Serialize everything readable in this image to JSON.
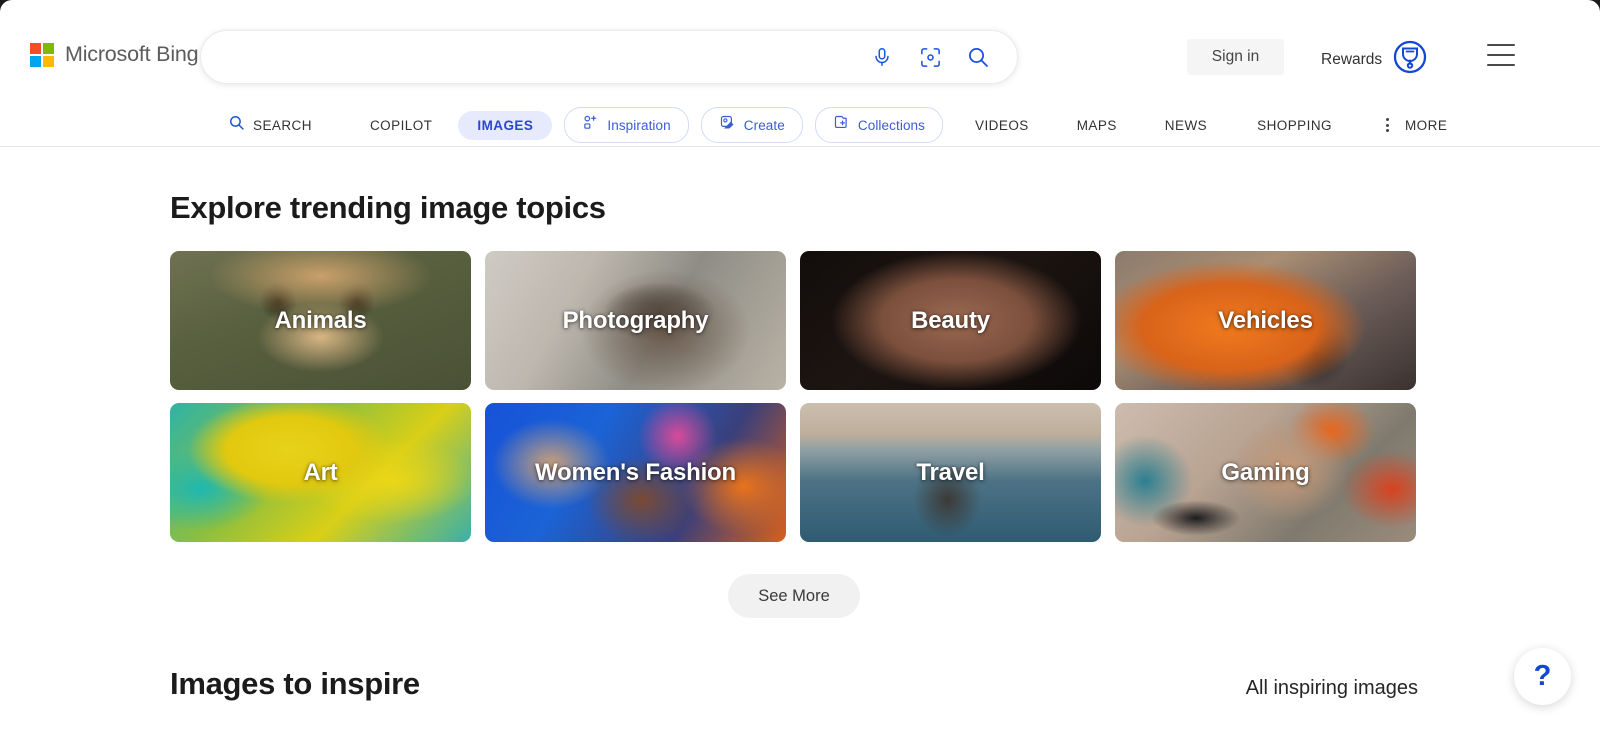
{
  "browser": {
    "frame_color": "#1b1b1b"
  },
  "header": {
    "brand": {
      "name": "Microsoft Bing",
      "logo": "microsoft-logo"
    },
    "search": {
      "value": "",
      "placeholder": "",
      "icons": [
        "microphone-icon",
        "visual-search-icon",
        "search-icon"
      ]
    },
    "sign_in_label": "Sign in",
    "rewards_label": "Rewards",
    "rewards_icon": "rewards-medal-icon",
    "menu_icon": "hamburger-menu-icon"
  },
  "nav": {
    "items": [
      {
        "label": "SEARCH",
        "style": "plain",
        "icon": "search-icon"
      },
      {
        "label": "COPILOT",
        "style": "plain",
        "icon": ""
      },
      {
        "label": "IMAGES",
        "style": "active",
        "icon": ""
      },
      {
        "label": "Inspiration",
        "style": "pill",
        "icon": "inspiration-icon"
      },
      {
        "label": "Create",
        "style": "pill",
        "icon": "create-icon"
      },
      {
        "label": "Collections",
        "style": "pill",
        "icon": "collections-icon"
      },
      {
        "label": "VIDEOS",
        "style": "plain",
        "icon": ""
      },
      {
        "label": "MAPS",
        "style": "plain",
        "icon": ""
      },
      {
        "label": "NEWS",
        "style": "plain",
        "icon": ""
      },
      {
        "label": "SHOPPING",
        "style": "plain",
        "icon": ""
      },
      {
        "label": "MORE",
        "style": "plain",
        "icon": "more-dots-icon"
      }
    ]
  },
  "main": {
    "trending_title": "Explore trending image topics",
    "topics": [
      {
        "label": "Animals",
        "art": "art-animals"
      },
      {
        "label": "Photography",
        "art": "art-photography"
      },
      {
        "label": "Beauty",
        "art": "art-beauty"
      },
      {
        "label": "Vehicles",
        "art": "art-vehicles"
      },
      {
        "label": "Art",
        "art": "art-art"
      },
      {
        "label": "Women's Fashion",
        "art": "art-fashion"
      },
      {
        "label": "Travel",
        "art": "art-travel"
      },
      {
        "label": "Gaming",
        "art": "art-gaming"
      }
    ],
    "see_more_label": "See More",
    "inspire_title": "Images to inspire",
    "inspire_link_label": "All inspiring images"
  },
  "help": {
    "icon": "question-mark-icon",
    "label": "?"
  },
  "colors": {
    "accent_blue": "#1348d4",
    "nav_blue": "#3b5bdb",
    "active_pill_bg": "#e6eafc",
    "button_gray": "#f1f1f1"
  }
}
